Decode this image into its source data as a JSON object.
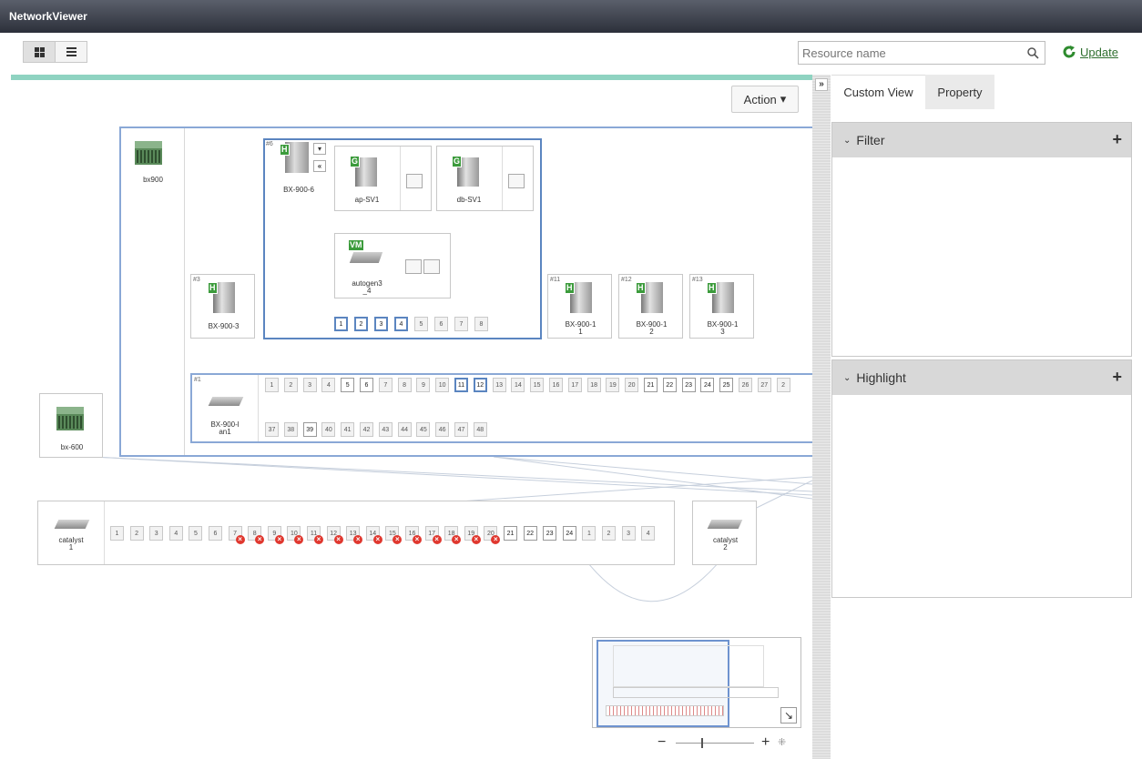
{
  "app": {
    "title": "NetworkViewer"
  },
  "toolbar": {
    "search_placeholder": "Resource name",
    "update_label": "Update"
  },
  "canvas": {
    "action_label": "Action"
  },
  "nodes": {
    "bx900": "bx900",
    "bx600": "bx-600",
    "bx9006": {
      "num": "#6",
      "label": "BX-900-6"
    },
    "apsv1": "ap-SV1",
    "dbsv1": "db-SV1",
    "autogen": {
      "l1": "autogen3",
      "l2": "_4"
    },
    "bx9003": {
      "num": "#3",
      "label": "BX-900-3"
    },
    "bx90011": {
      "num": "#11",
      "l1": "BX-900-1",
      "l2": "1"
    },
    "bx90012": {
      "num": "#12",
      "l1": "BX-900-1",
      "l2": "2"
    },
    "bx90013": {
      "num": "#13",
      "l1": "BX-900-1",
      "l2": "3"
    },
    "lan": {
      "num": "#1",
      "l1": "BX-900-l",
      "l2": "an1"
    },
    "cat1": {
      "l1": "catalyst",
      "l2": "1"
    },
    "cat2": {
      "l1": "catalyst",
      "l2": "2"
    }
  },
  "tags": {
    "h": "H",
    "g": "G",
    "vm": "VM"
  },
  "blade_ports": [
    "1",
    "2",
    "3",
    "4",
    "5",
    "6",
    "7",
    "8"
  ],
  "lan_ports_row1": [
    "1",
    "2",
    "3",
    "4",
    "5",
    "6",
    "7",
    "8",
    "9",
    "10",
    "11",
    "12",
    "13",
    "14",
    "15",
    "16",
    "17",
    "18",
    "19",
    "20",
    "21",
    "22",
    "23",
    "24",
    "25",
    "26",
    "27",
    "2"
  ],
  "lan_ports_row2": [
    "37",
    "38",
    "39",
    "40",
    "41",
    "42",
    "43",
    "44",
    "45",
    "46",
    "47",
    "48"
  ],
  "cat_ports": [
    "1",
    "2",
    "3",
    "4",
    "5",
    "6",
    "7",
    "8",
    "9",
    "10",
    "11",
    "12",
    "13",
    "14",
    "15",
    "16",
    "17",
    "18",
    "19",
    "20",
    "21",
    "22",
    "23",
    "24",
    "1",
    "2",
    "3",
    "4"
  ],
  "panel": {
    "collapse_label": "»",
    "collapse_left": "«",
    "tabs": [
      "Custom View",
      "Property"
    ],
    "filter_label": "Filter",
    "highlight_label": "Highlight",
    "plus": "+"
  },
  "zoom": {
    "minus": "−",
    "plus": "+"
  },
  "colors": {
    "accent_bar": "#8fd3c1",
    "selection": "#5b85c0",
    "error": "#e0382f",
    "tag": "#3c9b3c"
  }
}
